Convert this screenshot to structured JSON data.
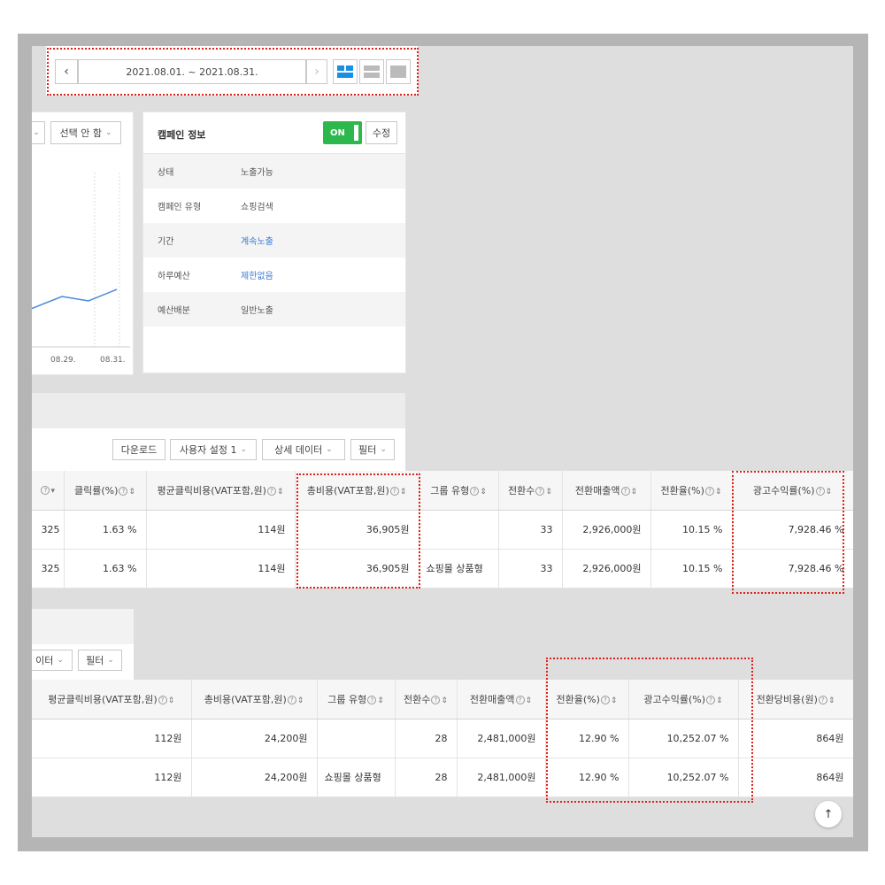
{
  "date_bar": {
    "prev_icon": "chevron-left-icon",
    "range_text": "2021.08.01. ~ 2021.08.31.",
    "next_icon": "chevron-right-icon",
    "view_icons": [
      "layout-split-icon",
      "layout-rows-icon",
      "layout-single-icon"
    ],
    "active_view_color": "#1a8fe6"
  },
  "chart_panel": {
    "dropdown_1": "",
    "dropdown_2": "선택 안 함",
    "x_ticks": [
      "08.29.",
      "08.31."
    ],
    "line_color": "#4a8ad6"
  },
  "campaign_info": {
    "title": "캠페인 정보",
    "toggle_label": "ON",
    "toggle_color": "#2db84d",
    "edit_label": "수정",
    "rows": [
      {
        "key": "상태",
        "value": "노출가능"
      },
      {
        "key": "캠페인 유형",
        "value": "쇼핑검색"
      },
      {
        "key": "기간",
        "value": "계속노출"
      },
      {
        "key": "하루예산",
        "value": "제한없음"
      },
      {
        "key": "예산배분",
        "value": "일반노출"
      }
    ]
  },
  "toolbar1": {
    "download": "다운로드",
    "user_setting": "사용자 설정 1",
    "detail_data": "상세 데이터",
    "filter": "필터"
  },
  "table1": {
    "headers": [
      "",
      "클릭률(%)",
      "평균클릭비용(VAT포함,원)",
      "총비용(VAT포함,원)",
      "그룹 유형",
      "전환수",
      "전환매출액",
      "전환율(%)",
      "광고수익률(%)"
    ],
    "rows": [
      [
        "325",
        "1.63 %",
        "114원",
        "36,905원",
        "",
        "33",
        "2,926,000원",
        "10.15 %",
        "7,928.46 %"
      ],
      [
        "325",
        "1.63 %",
        "114원",
        "36,905원",
        "쇼핑몰 상품형",
        "33",
        "2,926,000원",
        "10.15 %",
        "7,928.46 %"
      ]
    ]
  },
  "toolbar2": {
    "detail_data_partial": "이터",
    "filter": "필터"
  },
  "table2": {
    "headers": [
      "평균클릭비용(VAT포함,원)",
      "총비용(VAT포함,원)",
      "그룹 유형",
      "전환수",
      "전환매출액",
      "전환율(%)",
      "광고수익률(%)",
      "전환당비용(원)"
    ],
    "rows": [
      [
        "112원",
        "24,200원",
        "",
        "28",
        "2,481,000원",
        "12.90 %",
        "10,252.07 %",
        "864원"
      ],
      [
        "112원",
        "24,200원",
        "쇼핑몰 상품형",
        "28",
        "2,481,000원",
        "12.90 %",
        "10,252.07 %",
        "864원"
      ]
    ]
  },
  "scroll_top_icon": "arrow-up-icon",
  "highlight_color": "#e0201a"
}
